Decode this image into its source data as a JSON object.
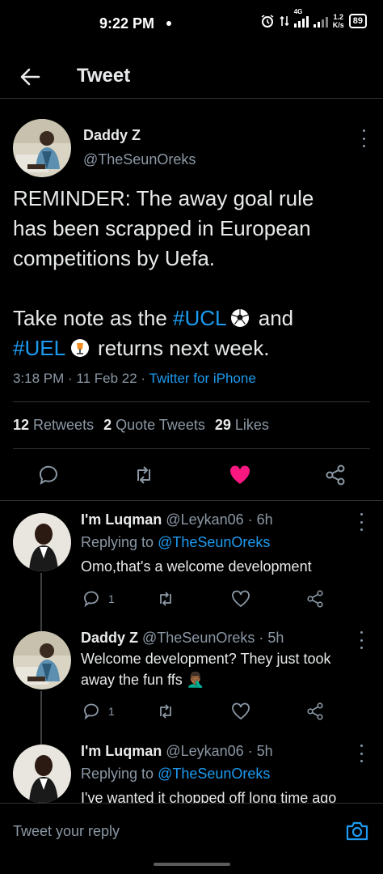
{
  "status_bar": {
    "time": "9:22 PM",
    "network": "4G",
    "speed_value": "1.2",
    "speed_unit": "K/s",
    "battery": "89"
  },
  "header": {
    "title": "Tweet"
  },
  "tweet": {
    "author_name": "Daddy Z",
    "author_handle": "@TheSeunOreks",
    "text_line1": "REMINDER: The away goal rule",
    "text_line2": "has been scrapped in European",
    "text_line3": "competitions by Uefa.",
    "text_line4_prefix": "Take note as the ",
    "hashtag_ucl": "#UCL",
    "text_line4_suffix": " and",
    "hashtag_uel": "#UEL",
    "text_line5_suffix": "returns next week.",
    "timestamp": "3:18 PM · 11 Feb 22 · ",
    "source": "Twitter for iPhone",
    "retweets_count": "12",
    "retweets_label": " Retweets",
    "quotes_count": "2",
    "quotes_label": " Quote Tweets",
    "likes_count": "29",
    "likes_label": " Likes",
    "liked": true
  },
  "replies": [
    {
      "name": "I'm Luqman",
      "handle_time": " @Leykan06 · 6h",
      "replying_prefix": "Replying to ",
      "replying_to": "@TheSeunOreks",
      "text": "Omo,that's a welcome development",
      "reply_count": "1"
    },
    {
      "name": "Daddy Z",
      "handle_time": " @TheSeunOreks · 5h",
      "text_line1": "Welcome development? They just took",
      "text_line2": "away the fun ffs 🤦🏾‍♂️",
      "reply_count": "1"
    },
    {
      "name": "I'm Luqman",
      "handle_time": " @Leykan06 · 5h",
      "replying_prefix": "Replying to ",
      "replying_to": "@TheSeunOreks",
      "text": "I've wanted it chopped off long time ago"
    }
  ],
  "composer": {
    "placeholder": "Tweet your reply"
  },
  "colors": {
    "accent": "#1d9bf0",
    "like": "#f91880",
    "muted": "#8b98a5",
    "background": "#000000"
  }
}
